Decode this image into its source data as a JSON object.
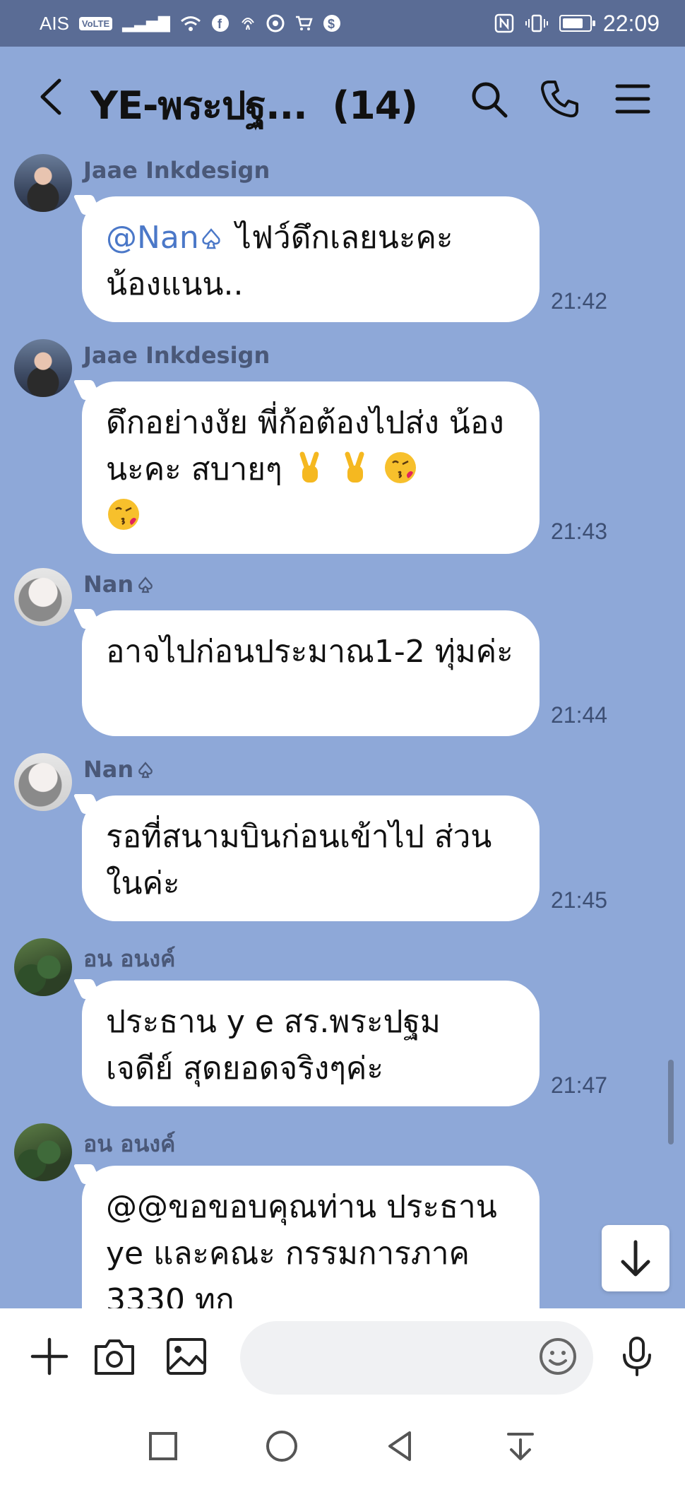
{
  "status_bar": {
    "carrier": "AIS",
    "volte": "VoLTE",
    "time": "22:09"
  },
  "header": {
    "title": "YE-พระปฐ...",
    "member_count": "(14)"
  },
  "messages": [
    {
      "sender": "Jaae Inkdesign",
      "mention": "@Nan",
      "text": "ไฟว์ดึกเลยนะคะ น้องแนน..",
      "time": "21:42"
    },
    {
      "sender": "Jaae Inkdesign",
      "text": "ดึกอย่างงัย พี่ก้อต้องไปส่ง น้องนะคะ สบายๆ",
      "time": "21:43"
    },
    {
      "sender": "Nan",
      "text": "อาจไปก่อนประมาณ1-2 ทุ่มค่ะ",
      "time": "21:44"
    },
    {
      "sender": "Nan",
      "text": "รอที่สนามบินก่อนเข้าไป ส่วนในค่ะ",
      "time": "21:45"
    },
    {
      "sender": "อน อนงค์",
      "text": "ประธาน y e สร.พระปฐม เจดีย์  สุดยอดจริงๆค่ะ",
      "time": "21:47"
    },
    {
      "sender": "อน อนงค์",
      "text": "@@ขอขอบคุณท่าน ประธาน ye และคณะ กรรมการภาค 3330 ทุก",
      "time": ""
    }
  ],
  "input": {
    "placeholder": ""
  },
  "colors": {
    "chat_background": "#8ea8d8",
    "status_bar": "#5a6c95",
    "mention": "#4b78c8",
    "bubble": "#ffffff"
  },
  "icons": [
    "back-icon",
    "search-icon",
    "phone-icon",
    "menu-icon",
    "plus-icon",
    "camera-icon",
    "image-icon",
    "emoji-icon",
    "microphone-icon",
    "arrow-down-icon",
    "square-nav-icon",
    "circle-nav-icon",
    "triangle-nav-icon",
    "notification-nav-icon"
  ]
}
